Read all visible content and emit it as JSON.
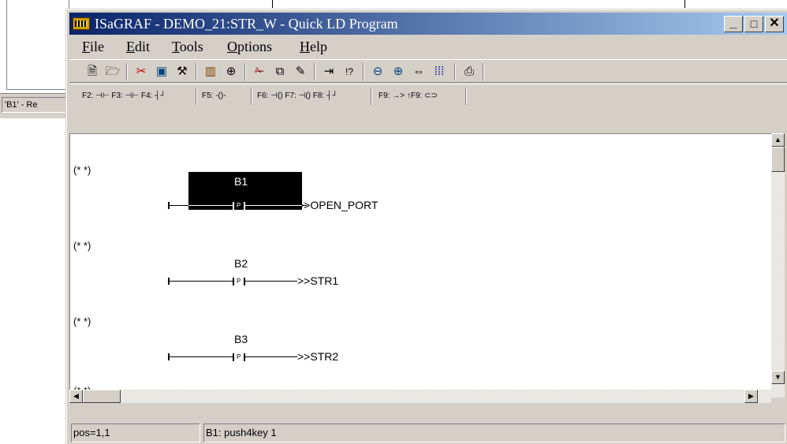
{
  "background_window": {
    "status_text": "'B1' - Re"
  },
  "window": {
    "title": "ISaGRAF - DEMO_21:STR_W - Quick LD Program",
    "controls": {
      "minimize": "_",
      "maximize": "□",
      "close": "✕"
    }
  },
  "menu": [
    {
      "label": "File",
      "mnemonic": "F"
    },
    {
      "label": "Edit",
      "mnemonic": "E"
    },
    {
      "label": "Tools",
      "mnemonic": "T"
    },
    {
      "label": "Options",
      "mnemonic": "O"
    },
    {
      "label": "Help",
      "mnemonic": "H"
    }
  ],
  "toolbar_icons": [
    "new-icon",
    "open-icon",
    "cut-tool-icon",
    "monitor-icon",
    "compile-icon",
    "dictionary-icon",
    "variables-icon",
    "scissors-icon",
    "copy-icon",
    "paste-icon",
    "insert-icon",
    "cross-reference-icon",
    "zoom-out-icon",
    "zoom-in-icon",
    "fit-icon",
    "grid-icon",
    "print-icon"
  ],
  "fkeys": {
    "group1": "F2: ⊣⊢  F3: ⊣⊢  F4: ┤┘",
    "group2": "F5: -()-",
    "group3": "F6: ⊣()  F7: ⊣()  F8: ┤┘",
    "group4": "F9: →>  ↑F9: ⊂⊃"
  },
  "rungs": [
    {
      "comment": "(* *)",
      "contact": "B1",
      "contact_type": "P",
      "jump": ">>OPEN_PORT",
      "selected": true
    },
    {
      "comment": "(* *)",
      "contact": "B2",
      "contact_type": "P",
      "jump": ">>STR1",
      "selected": false
    },
    {
      "comment": "(* *)",
      "contact": "B3",
      "contact_type": "P",
      "jump": ">>STR2",
      "selected": false
    },
    {
      "comment": "(* *)"
    }
  ],
  "status": {
    "position": "pos=1,1",
    "message": "B1: push4key 1"
  }
}
